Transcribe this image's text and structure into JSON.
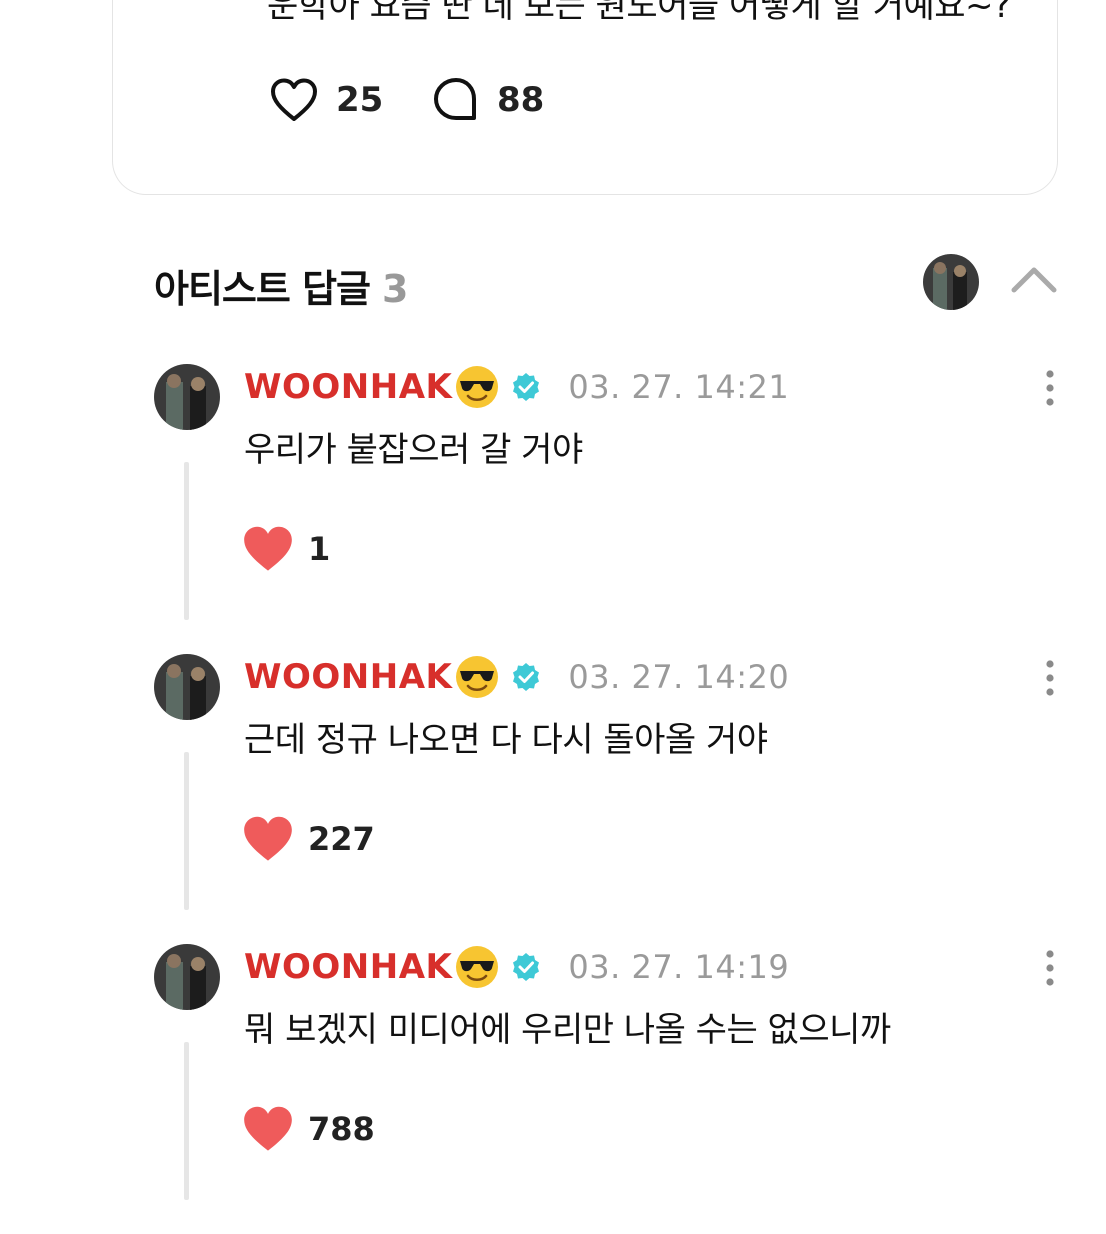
{
  "post": {
    "text": "운학아 요즘 딴 데 보는 원도어들 어떻게 할 거예요~?",
    "likes": "25",
    "comments": "88"
  },
  "section": {
    "title": "아티스트 답글",
    "count": "3"
  },
  "replies": [
    {
      "author": "WOONHAK",
      "timestamp": "03. 27. 14:21",
      "text": "우리가 붙잡으러 갈 거야",
      "likes": "1"
    },
    {
      "author": "WOONHAK",
      "timestamp": "03. 27. 14:20",
      "text": "근데 정규 나오면 다 다시 돌아올 거야",
      "likes": "227"
    },
    {
      "author": "WOONHAK",
      "timestamp": "03. 27. 14:19",
      "text": "뭐 보겠지 미디어에 우리만 나올 수는 없으니까",
      "likes": "788"
    }
  ],
  "icons": {
    "author_emoji": "sunglasses-emoji",
    "verified": "verified-badge-icon",
    "like": "heart-icon",
    "comment": "comment-bubble-icon"
  },
  "colors": {
    "author": "#d72f2b",
    "heart_filled": "#ef5b5b",
    "verified": "#3ec9d6",
    "muted": "#9a9a9a"
  }
}
